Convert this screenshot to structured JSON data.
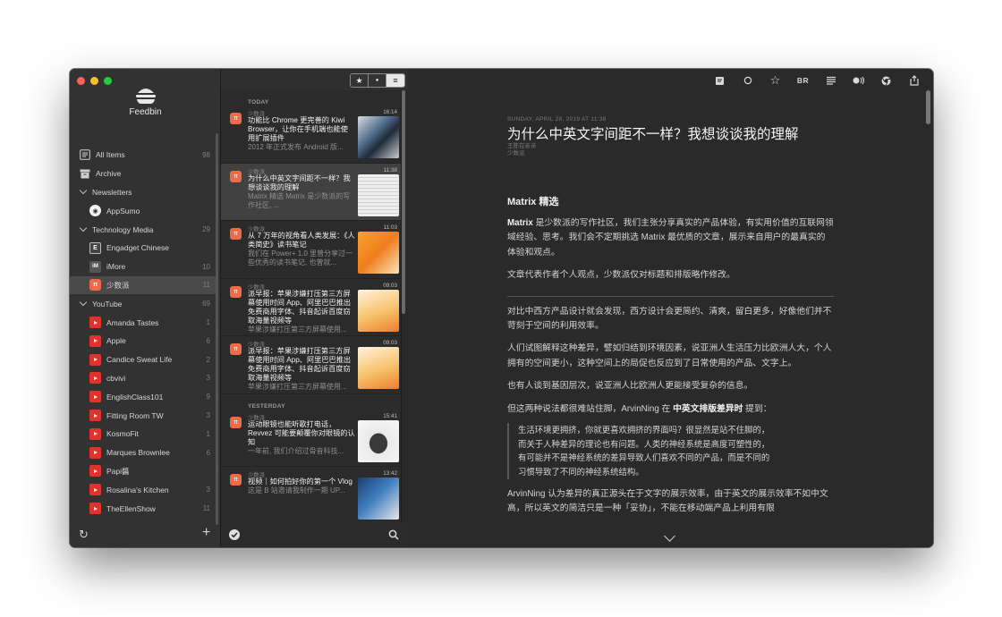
{
  "app": {
    "name": "Feedbin"
  },
  "sidebar": {
    "items": [
      {
        "type": "item",
        "label": "All Items",
        "count": "98",
        "icon": "all-items-icon"
      },
      {
        "type": "item",
        "label": "Archive",
        "count": "",
        "icon": "archive-icon"
      },
      {
        "type": "group",
        "label": "Newsletters",
        "count": ""
      },
      {
        "type": "feed",
        "label": "AppSumo",
        "count": "",
        "icon": "appsumo-icon"
      },
      {
        "type": "group",
        "label": "Technology Media",
        "count": "29"
      },
      {
        "type": "feed",
        "label": "Engadget Chinese",
        "count": "",
        "icon": "engadget-icon"
      },
      {
        "type": "feed",
        "label": "iMore",
        "count": "10",
        "icon": "imore-icon"
      },
      {
        "type": "feed",
        "label": "少数派",
        "count": "11",
        "icon": "sspai-icon",
        "selected": true
      },
      {
        "type": "group",
        "label": "YouTube",
        "count": "69"
      },
      {
        "type": "feed",
        "label": "Amanda Tastes",
        "count": "1",
        "icon": "youtube-icon"
      },
      {
        "type": "feed",
        "label": "Apple",
        "count": "6",
        "icon": "youtube-icon"
      },
      {
        "type": "feed",
        "label": "Candice Sweat Life",
        "count": "2",
        "icon": "youtube-icon"
      },
      {
        "type": "feed",
        "label": "cbvivi",
        "count": "3",
        "icon": "youtube-icon"
      },
      {
        "type": "feed",
        "label": "EnglishClass101",
        "count": "9",
        "icon": "youtube-icon"
      },
      {
        "type": "feed",
        "label": "Fitting Room TW",
        "count": "3",
        "icon": "youtube-icon"
      },
      {
        "type": "feed",
        "label": "KosmoFit",
        "count": "1",
        "icon": "youtube-icon"
      },
      {
        "type": "feed",
        "label": "Marques Brownlee",
        "count": "6",
        "icon": "youtube-icon"
      },
      {
        "type": "feed",
        "label": "Papi醬",
        "count": "",
        "icon": "youtube-icon"
      },
      {
        "type": "feed",
        "label": "Rosalina's Kitchen",
        "count": "3",
        "icon": "youtube-icon"
      },
      {
        "type": "feed",
        "label": "TheEllenShow",
        "count": "11",
        "icon": "youtube-icon"
      }
    ]
  },
  "filters": {
    "starred": "★",
    "unread": "●",
    "all": "≡"
  },
  "list": {
    "sections": [
      {
        "label": "TODAY",
        "entries": [
          {
            "source": "少数派",
            "time": "16:14",
            "title": "功能比 Chrome 更完善的 Kiwi Browser，让你在手机端也能使用扩展插件",
            "summary": "2012 年正式发布 Android 版...",
            "thumb": "phone"
          },
          {
            "source": "少数派",
            "time": "11:38",
            "title": "为什么中英文字间距不一样？我想谈谈我的理解",
            "summary": "Matrix 精选 Matrix 是少数派的写作社区, ...",
            "thumb": "doc",
            "selected": true
          },
          {
            "source": "少数派",
            "time": "11:03",
            "title": "从 7 万年的视角看人类发展：《人类简史》读书笔记",
            "summary": "我们在 Power+ 1.0 里曾分享过一些优秀的读书笔记, 也曾就...",
            "thumb": "book"
          },
          {
            "source": "少数派",
            "time": "09:03",
            "title": "派早报：苹果涉嫌打压第三方屏幕使用时间 App、阿里巴巴推出免费商用字体、抖音起诉百度窃取海量视频等",
            "summary": "苹果涉嫌打压第三方屏幕使用...",
            "thumb": "poster"
          },
          {
            "source": "少数派",
            "time": "09:03",
            "title": "派早报：苹果涉嫌打压第三方屏幕使用时间 App、阿里巴巴推出免费商用字体、抖音起诉百度窃取海量视频等",
            "summary": "苹果涉嫌打压第三方屏幕使用...",
            "thumb": "poster"
          }
        ]
      },
      {
        "label": "YESTERDAY",
        "entries": [
          {
            "source": "少数派",
            "time": "15:41",
            "title": "运动眼镜也能听歌打电话，Revvez 可能要颠覆你对眼镜的认知",
            "summary": "一年前, 我们介绍过骨音科技...",
            "thumb": "glasses"
          },
          {
            "source": "少数派",
            "time": "13:42",
            "title": "视频｜如何拍好你的第一个 Vlog",
            "summary": "这是 B 站邀请我制作一期 UP...",
            "thumb": "vlog"
          }
        ]
      }
    ]
  },
  "reader": {
    "toolbar": [
      "note-icon",
      "circle-icon",
      "star-icon",
      "BR",
      "list-icon",
      "audio-icon",
      "chrome-icon",
      "share-icon"
    ],
    "meta": "SUNDAY, APRIL 28, 2019 AT 11:38",
    "title": "为什么中英文字间距不一样？我想谈谈我的理解",
    "subtitle": "王陈在亲亲",
    "source": "少数派",
    "heading": "Matrix 精选",
    "p1_bold": "Matrix",
    "p1_rest": " 是少数派的写作社区，我们主张分享真实的产品体验，有实用价值的互联网领域经验、思考。我们会不定期挑选 Matrix 最优质的文章，展示来自用户的最真实的体验和观点。",
    "p2": "文章代表作者个人观点，少数派仅对标题和排版略作修改。",
    "p3": "对比中西方产品设计就会发现，西方设计会更简约、清爽，留白更多，好像他们并不苛刻于空间的利用效率。",
    "p4": "人们试图解释这种差异，譬如归结到环境因素，说亚洲人生活压力比欧洲人大，个人拥有的空间更小，这种空间上的局促也反应到了日常使用的产品、文字上。",
    "p5": "也有人谈到基因层次，说亚洲人比欧洲人更能接受复杂的信息。",
    "p6_a": "但这两种说法都很难站住脚，ArvinNing 在 ",
    "p6_bold": "中英文排版差异时",
    "p6_b": " 提到：",
    "quote": [
      "生活环境更拥挤，你就更喜欢拥挤的界面吗？很显然是站不住脚的，",
      "而关于人种差异的理论也有问题。人类的神经系统是高度可塑性的，",
      "有可能并不是神经系统的差异导致人们喜欢不同的产品，而是不同的",
      "习惯导致了不同的神经系统结构。"
    ],
    "p7": "ArvinNing 认为差异的真正源头在于文字的展示效率，由于英文的展示效率不如中文高，所以英文的简洁只是一种「妥协」，不能在移动端产品上利用有限"
  }
}
